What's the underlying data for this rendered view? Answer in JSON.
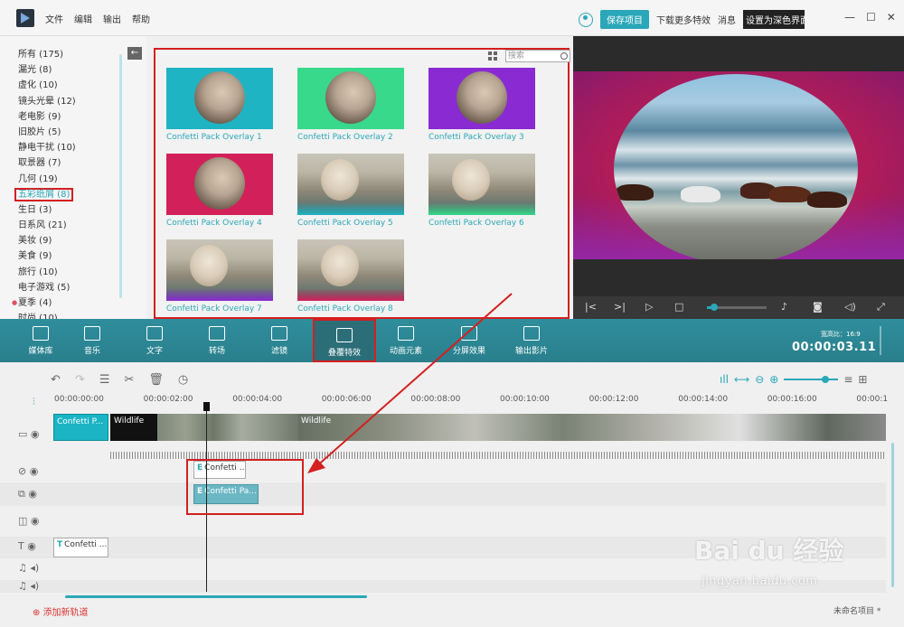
{
  "menu": [
    "文件",
    "编辑",
    "输出",
    "帮助"
  ],
  "titlebar": {
    "save_button": "保存项目",
    "download_more": "下载更多特效",
    "messages": "消息",
    "dark_theme": "设置为深色界面",
    "window_controls": [
      "—",
      "☐",
      "✕"
    ]
  },
  "categories": [
    "所有 (175)",
    "漏光 (8)",
    "虚化 (10)",
    "镜头光晕 (12)",
    "老电影 (9)",
    "旧胶片 (5)",
    "静电干扰 (10)",
    "取景器 (7)",
    "几何 (19)",
    "五彩纸屑 (8)",
    "生日 (3)",
    "日系风 (21)",
    "美妆 (9)",
    "美食 (9)",
    "旅行 (10)",
    "电子游戏 (5)",
    "夏季 (4)",
    "时尚 (10)"
  ],
  "selected_category_index": 9,
  "search_placeholder": "搜索",
  "overlays": [
    "Confetti Pack Overlay 1",
    "Confetti Pack Overlay 2",
    "Confetti Pack Overlay 3",
    "Confetti Pack Overlay 4",
    "Confetti Pack Overlay 5",
    "Confetti Pack Overlay 6",
    "Confetti Pack Overlay 7",
    "Confetti Pack Overlay 8"
  ],
  "overlay_colors": [
    "#1fb4c4",
    "#38d98a",
    "#8a2ad2",
    "#d2205a",
    "#1fb4c4",
    "#38d98a",
    "#8a2ad2",
    "#d2205a"
  ],
  "toolbar": {
    "items": [
      "媒体库",
      "音乐",
      "文字",
      "转场",
      "滤镜",
      "叠覆特效",
      "动画元素",
      "分屏效果",
      "输出影片"
    ],
    "active_index": 5,
    "aspect_label": "宽高比：",
    "aspect_value": "16:9",
    "timecode": "00:00:03.11"
  },
  "timeline": {
    "ruler_ticks": [
      "00:00:00:00",
      "00:00:02:00",
      "00:00:04:00",
      "00:00:06:00",
      "00:00:08:00",
      "00:00:10:00",
      "00:00:12:00",
      "00:00:14:00",
      "00:00:16:00",
      "00:00:1"
    ],
    "video_clips": [
      "Confetti P...",
      "Wildlife",
      "Wildlife"
    ],
    "fx_clips": [
      "Confetti ...",
      "Confetti Pa..."
    ],
    "text_clip": "Confetti ...",
    "add_track": "添加新轨道",
    "project_name": "未命名项目 *"
  },
  "playback_progress": 0.12,
  "accent_color": "#2aa7b8",
  "highlight_color": "#d31f1f",
  "watermark": {
    "logo": "Bai du 经验",
    "url": "jingyan.baidu.com"
  }
}
